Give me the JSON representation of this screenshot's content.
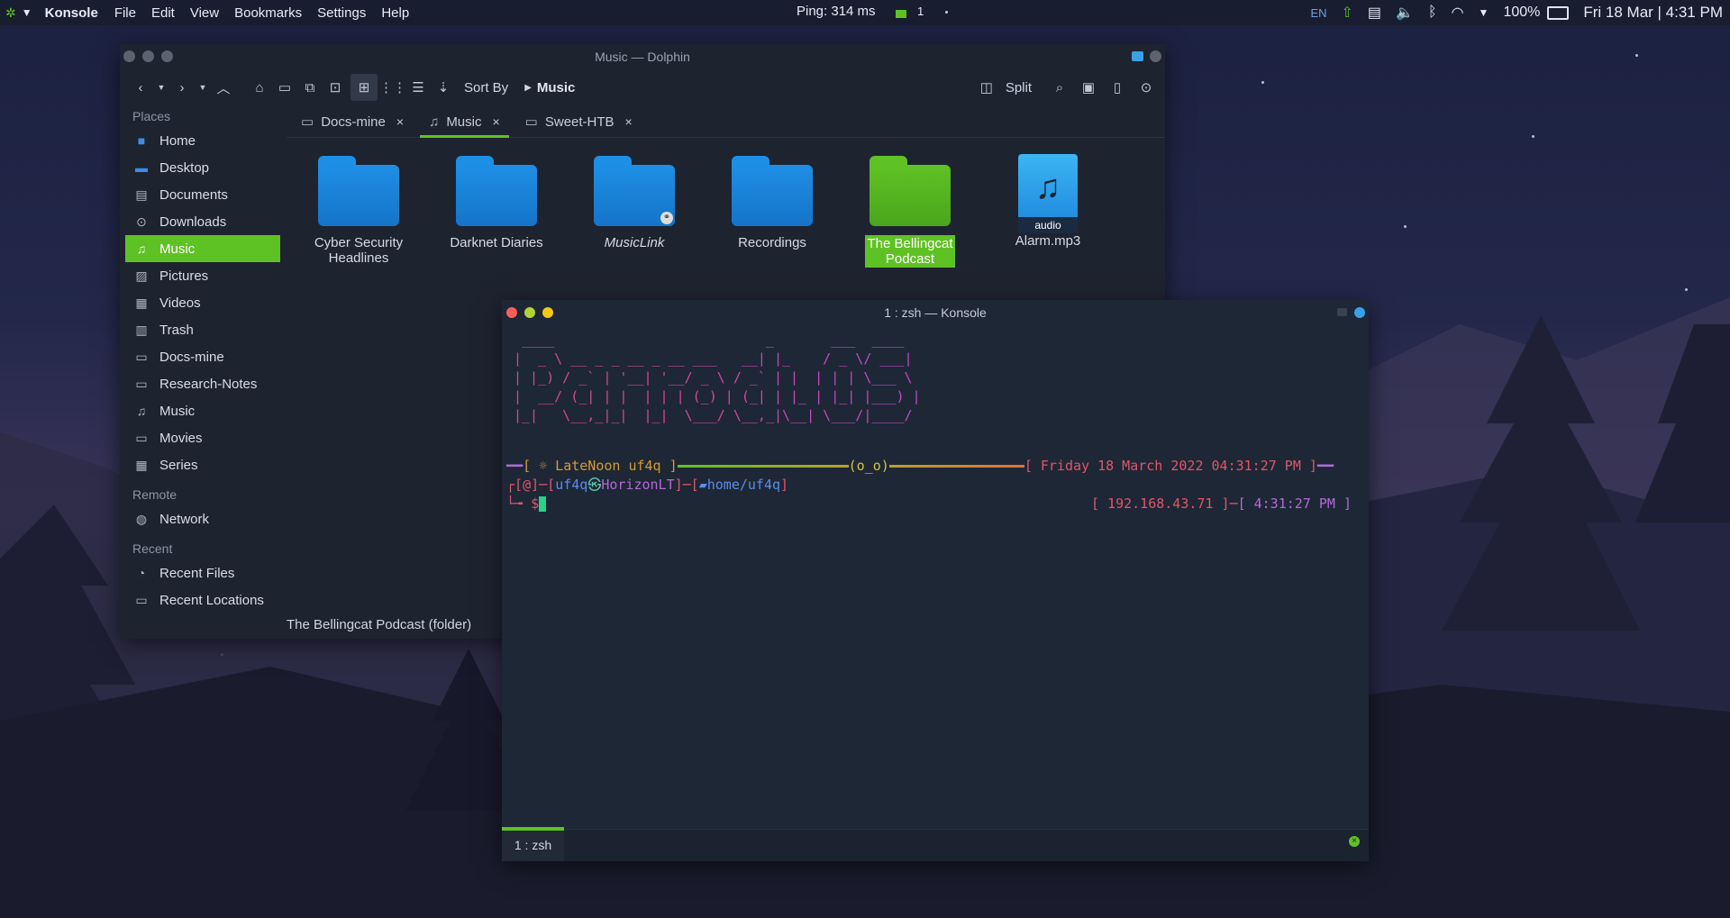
{
  "topbar": {
    "app_name": "Konsole",
    "menu": [
      "File",
      "Edit",
      "View",
      "Bookmarks",
      "Settings",
      "Help"
    ],
    "ping": "Ping: 314 ms",
    "workspace": "1",
    "lang": "EN",
    "battery": "100%",
    "datetime": "Fri 18 Mar | 4:31 PM"
  },
  "dolphin": {
    "title": "Music — Dolphin",
    "sort_label": "Sort By",
    "breadcrumb": "Music",
    "split_label": "Split",
    "places_header": "Places",
    "places": [
      {
        "label": "Home",
        "icon": "home-folder-icon"
      },
      {
        "label": "Desktop",
        "icon": "desktop-icon"
      },
      {
        "label": "Documents",
        "icon": "documents-icon"
      },
      {
        "label": "Downloads",
        "icon": "downloads-icon"
      },
      {
        "label": "Music",
        "icon": "music-icon",
        "active": true
      },
      {
        "label": "Pictures",
        "icon": "pictures-icon"
      },
      {
        "label": "Videos",
        "icon": "videos-icon"
      },
      {
        "label": "Trash",
        "icon": "trash-icon"
      },
      {
        "label": "Docs-mine",
        "icon": "folder-icon"
      },
      {
        "label": "Research-Notes",
        "icon": "folder-icon"
      },
      {
        "label": "Music",
        "icon": "music-icon"
      },
      {
        "label": "Movies",
        "icon": "folder-icon"
      },
      {
        "label": "Series",
        "icon": "videos-icon"
      }
    ],
    "remote_header": "Remote",
    "remote": [
      {
        "label": "Network",
        "icon": "network-icon"
      }
    ],
    "recent_header": "Recent",
    "recent": [
      {
        "label": "Recent Files",
        "icon": "recent-files-icon"
      },
      {
        "label": "Recent Locations",
        "icon": "recent-locations-icon"
      }
    ],
    "tabs": [
      {
        "label": "Docs-mine",
        "close": "×"
      },
      {
        "label": "Music",
        "close": "×",
        "active": true
      },
      {
        "label": "Sweet-HTB",
        "close": "×"
      }
    ],
    "items": [
      {
        "label": "Cyber Security Headlines",
        "type": "folder",
        "color": "#1e8fe6"
      },
      {
        "label": "Darknet Diaries",
        "type": "folder",
        "color": "#1e8fe6"
      },
      {
        "label": "MusicLink",
        "type": "link",
        "color": "#1e8fe6"
      },
      {
        "label": "Recordings",
        "type": "folder",
        "color": "#1e8fe6"
      },
      {
        "label": "The Bellingcat Podcast",
        "type": "folder",
        "color": "#5fc224",
        "selected": true
      },
      {
        "label": "Alarm.mp3",
        "type": "audio",
        "badge": "audio",
        "color": "#2aa3ef"
      }
    ],
    "status": "The Bellingcat Podcast (folder)"
  },
  "konsole": {
    "title": "1 : zsh — Konsole",
    "banner": [
      " ____                          _       ___  ____  ",
      "|  _ \\ __ _ _ __ _ __ ___   __| |_    / _ \\/ ___| ",
      "| |_) / _` | '__| '__/ _ \\ / _` | |  | | | \\___ \\ ",
      "|  __/ (_| | |  | | | (_) | (_| | |_ | |_| |___) |",
      "|_|   \\__,_|_|  |_|  \\___/ \\__,_|\\__| \\___/|____/ "
    ],
    "line1_left": "[ ☼ LateNoon uf4q ]",
    "line1_mid": "(o_o)",
    "line1_right": "[ Friday 18 March 2022 04:31:27 PM ]",
    "line2_prefix": "┌[",
    "line2_user": "uf4q",
    "line2_host": "HorizonLT",
    "line2_path": "home/uf4q",
    "line3_prompt": "└╼ $",
    "ip": "[ 192.168.43.71 ]",
    "time": "[ 4:31:27 PM ]",
    "tab_label": "1 : zsh"
  }
}
